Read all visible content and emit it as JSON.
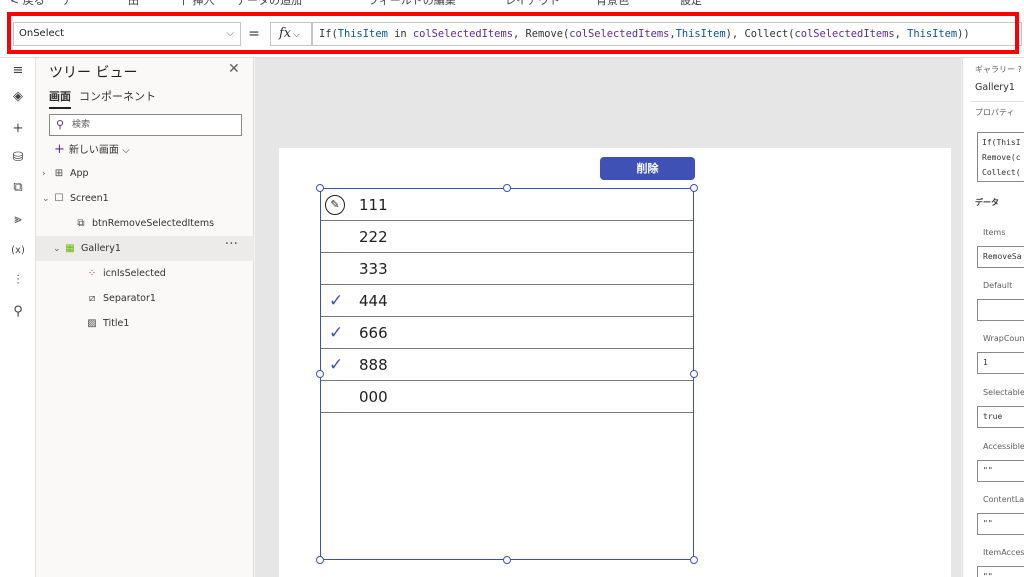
{
  "command_bar": {
    "items": [
      "< 戻る",
      "ア",
      "田",
      "十 挿入",
      "データの追加",
      "フィールドの編集",
      "レイアウト",
      "背景色",
      "設定"
    ]
  },
  "formula_bar": {
    "property": "OnSelect",
    "equals": "=",
    "fx": "fx",
    "tokens": [
      {
        "t": "If(",
        "c": "fn"
      },
      {
        "t": "ThisItem",
        "c": "kw"
      },
      {
        "t": " in ",
        "c": "fn"
      },
      {
        "t": "colSelectedItems",
        "c": "id"
      },
      {
        "t": ", ",
        "c": "fn"
      },
      {
        "t": "Remove(",
        "c": "fn"
      },
      {
        "t": "colSelectedItems",
        "c": "id"
      },
      {
        "t": ",",
        "c": "fn"
      },
      {
        "t": "ThisItem",
        "c": "kw"
      },
      {
        "t": "), ",
        "c": "fn"
      },
      {
        "t": "Collect(",
        "c": "fn"
      },
      {
        "t": "colSelectedItems",
        "c": "id"
      },
      {
        "t": ", ",
        "c": "fn"
      },
      {
        "t": "ThisItem",
        "c": "kw"
      },
      {
        "t": "))",
        "c": "fn"
      }
    ]
  },
  "rail": {
    "icons": [
      "hamburger-icon",
      "layers-icon",
      "plus-icon",
      "database-icon",
      "media-icon",
      "advanced-tools-icon",
      "variables-icon",
      "settings-icon",
      "search-icon"
    ],
    "glyphs": [
      "≡",
      "◈",
      "+",
      "⛁",
      "⧉",
      "⪢",
      "(x)",
      "⫶",
      "⚲"
    ]
  },
  "tree": {
    "title": "ツリー ビュー",
    "close": "✕",
    "tabs": [
      {
        "label": "画面",
        "active": true
      },
      {
        "label": "コンポーネント",
        "active": false
      }
    ],
    "search_placeholder": "検索",
    "new_screen": "新しい画面",
    "nodes": [
      {
        "label": "App",
        "indent": 0,
        "expander": "›",
        "icon": "⊞",
        "icon_name": "app-icon",
        "selected": false
      },
      {
        "label": "Screen1",
        "indent": 0,
        "expander": "⌄",
        "icon": "☐",
        "icon_name": "screen-icon",
        "selected": false
      },
      {
        "label": "btnRemoveSelectedItems",
        "indent": 2,
        "expander": "",
        "icon": "⧉",
        "icon_name": "button-icon",
        "selected": false
      },
      {
        "label": "Gallery1",
        "indent": 1,
        "expander": "⌄",
        "icon": "▦",
        "icon_name": "gallery-icon",
        "selected": true,
        "more": "···"
      },
      {
        "label": "icnIsSelected",
        "indent": 3,
        "expander": "",
        "icon": "⁘",
        "icon_name": "icons-icon",
        "selected": false
      },
      {
        "label": "Separator1",
        "indent": 3,
        "expander": "",
        "icon": "⧄",
        "icon_name": "shape-icon",
        "selected": false
      },
      {
        "label": "Title1",
        "indent": 3,
        "expander": "",
        "icon": "▨",
        "icon_name": "label-icon",
        "selected": false
      }
    ]
  },
  "canvas": {
    "button_label": "削除",
    "rows": [
      {
        "title": "111",
        "checked": false,
        "edit": true
      },
      {
        "title": "222",
        "checked": false,
        "edit": false
      },
      {
        "title": "333",
        "checked": false,
        "edit": false
      },
      {
        "title": "444",
        "checked": true,
        "edit": false
      },
      {
        "title": "666",
        "checked": true,
        "edit": false
      },
      {
        "title": "888",
        "checked": true,
        "edit": false
      },
      {
        "title": "000",
        "checked": false,
        "edit": false
      }
    ]
  },
  "properties": {
    "kind": "ギャラリー",
    "help": "?",
    "name": "Gallery1",
    "tab": "プロパティ",
    "code_lines": [
      "If(ThisI",
      "Remove(c",
      "Collect("
    ],
    "section": "データ",
    "fields": [
      {
        "label": "Items",
        "value": "RemoveSa"
      },
      {
        "label": "Default",
        "value": ""
      },
      {
        "label": "WrapCount",
        "value": "1"
      },
      {
        "label": "Selectable",
        "value": "true"
      },
      {
        "label": "AccessibleL",
        "value": "\"\""
      },
      {
        "label": "ContentLan",
        "value": "\"\""
      },
      {
        "label": "ItemAccess",
        "value": "\"\""
      }
    ]
  },
  "colors": {
    "accent": "#3f51b5",
    "highlight": "#ff0000",
    "keyword": "#0b5394",
    "identifier": "#5c2d91"
  }
}
